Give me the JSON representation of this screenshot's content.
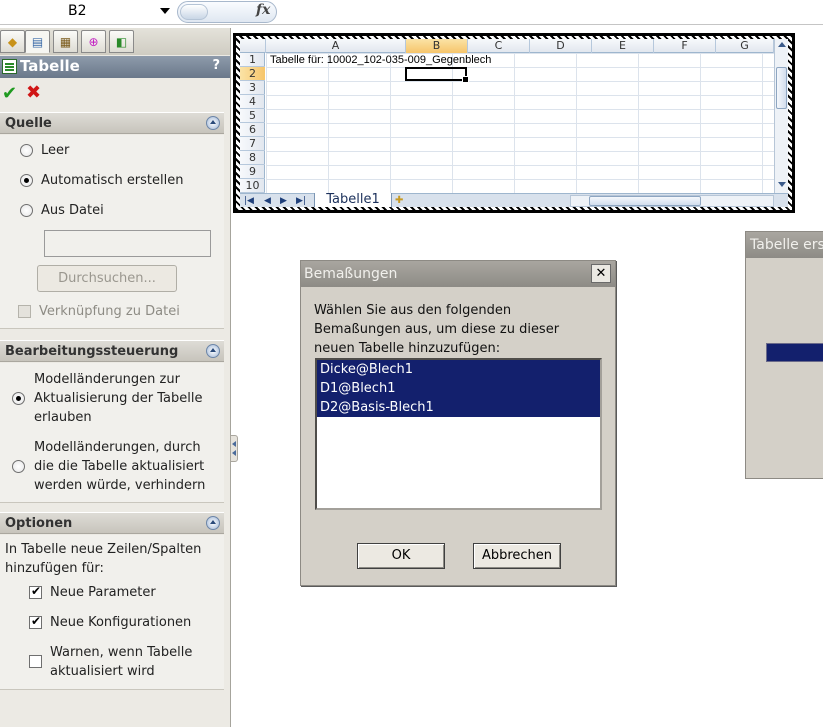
{
  "formula_bar": {
    "cell_ref": "B2",
    "fx": "fx"
  },
  "property_manager": {
    "title": "Tabelle",
    "help": "?",
    "quelle": {
      "header": "Quelle",
      "opt_leer": "Leer",
      "opt_auto": "Automatisch erstellen",
      "opt_datei": "Aus Datei",
      "path_value": "",
      "browse": "Durchsuchen...",
      "link": "Verknüpfung zu Datei"
    },
    "bearbeitung": {
      "header": "Bearbeitungssteuerung",
      "allow": [
        "Modelländerungen zur",
        "Aktualisierung der Tabelle",
        "erlauben"
      ],
      "block": [
        "Modelländerungen, durch",
        "die die Tabelle aktualisiert",
        "werden würde, verhindern"
      ]
    },
    "optionen": {
      "header": "Optionen",
      "intro": [
        "In Tabelle neue Zeilen/Spalten",
        "hinzufügen für:"
      ],
      "params": "Neue Parameter",
      "configs": "Neue Konfigurationen",
      "warn": [
        "Warnen, wenn Tabelle",
        "aktualisiert wird"
      ]
    }
  },
  "spreadsheet": {
    "columns": [
      "A",
      "B",
      "C",
      "D",
      "E",
      "F",
      "G"
    ],
    "rows": [
      "1",
      "2",
      "3",
      "4",
      "5",
      "6",
      "7",
      "8",
      "9",
      "10"
    ],
    "a1_text": "Tabelle für: 10002_102-035-009_Gegenblech",
    "sheet_tab": "Tabelle1"
  },
  "dimensions_dialog": {
    "title": "Bemaßungen",
    "close": "✕",
    "prompt": "Wählen Sie aus den folgenden Bemaßungen aus, um diese zu dieser neuen Tabelle hinzuzufügen:",
    "items": [
      "Dicke@Blech1",
      "D1@Blech1",
      "D2@Basis-Blech1"
    ],
    "ok": "OK",
    "cancel": "Abbrechen"
  },
  "create_dialog": {
    "title": "Tabelle ers"
  },
  "colors": {
    "selection": "#13206d",
    "titlebar": "#8d8b86",
    "panel": "#eceae4"
  }
}
